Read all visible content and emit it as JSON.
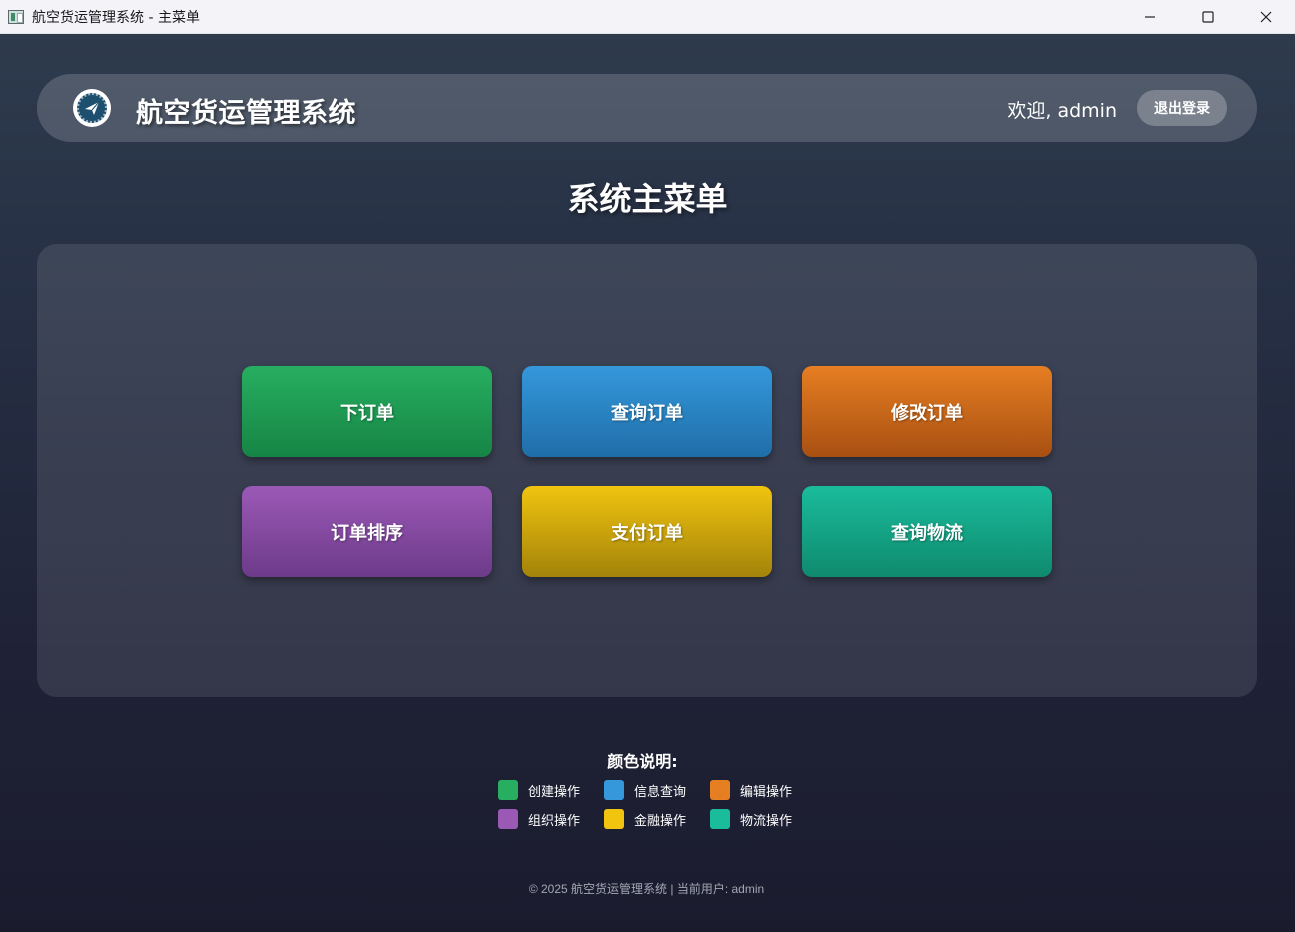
{
  "window": {
    "title": "航空货运管理系统 - 主菜单"
  },
  "header": {
    "logo_icon": "airplane-logo-icon",
    "brand": "航空货运管理系统",
    "welcome": "欢迎, admin",
    "logout_label": "退出登录"
  },
  "page_title": "系统主菜单",
  "menu": {
    "items": [
      {
        "label": "下订单",
        "color": "#27ae60"
      },
      {
        "label": "查询订单",
        "color": "#3498db"
      },
      {
        "label": "修改订单",
        "color": "#e67e22"
      },
      {
        "label": "订单排序",
        "color": "#9b59b6"
      },
      {
        "label": "支付订单",
        "color": "#f1c40f"
      },
      {
        "label": "查询物流",
        "color": "#1abc9c"
      }
    ]
  },
  "legend": {
    "title": "颜色说明:",
    "items": [
      {
        "label": "创建操作",
        "color": "#27ae60"
      },
      {
        "label": "信息查询",
        "color": "#3498db"
      },
      {
        "label": "编辑操作",
        "color": "#e67e22"
      },
      {
        "label": "组织操作",
        "color": "#9b59b6"
      },
      {
        "label": "金融操作",
        "color": "#f1c40f"
      },
      {
        "label": "物流操作",
        "color": "#1abc9c"
      }
    ]
  },
  "footer": "© 2025 航空货运管理系统 | 当前用户: admin"
}
